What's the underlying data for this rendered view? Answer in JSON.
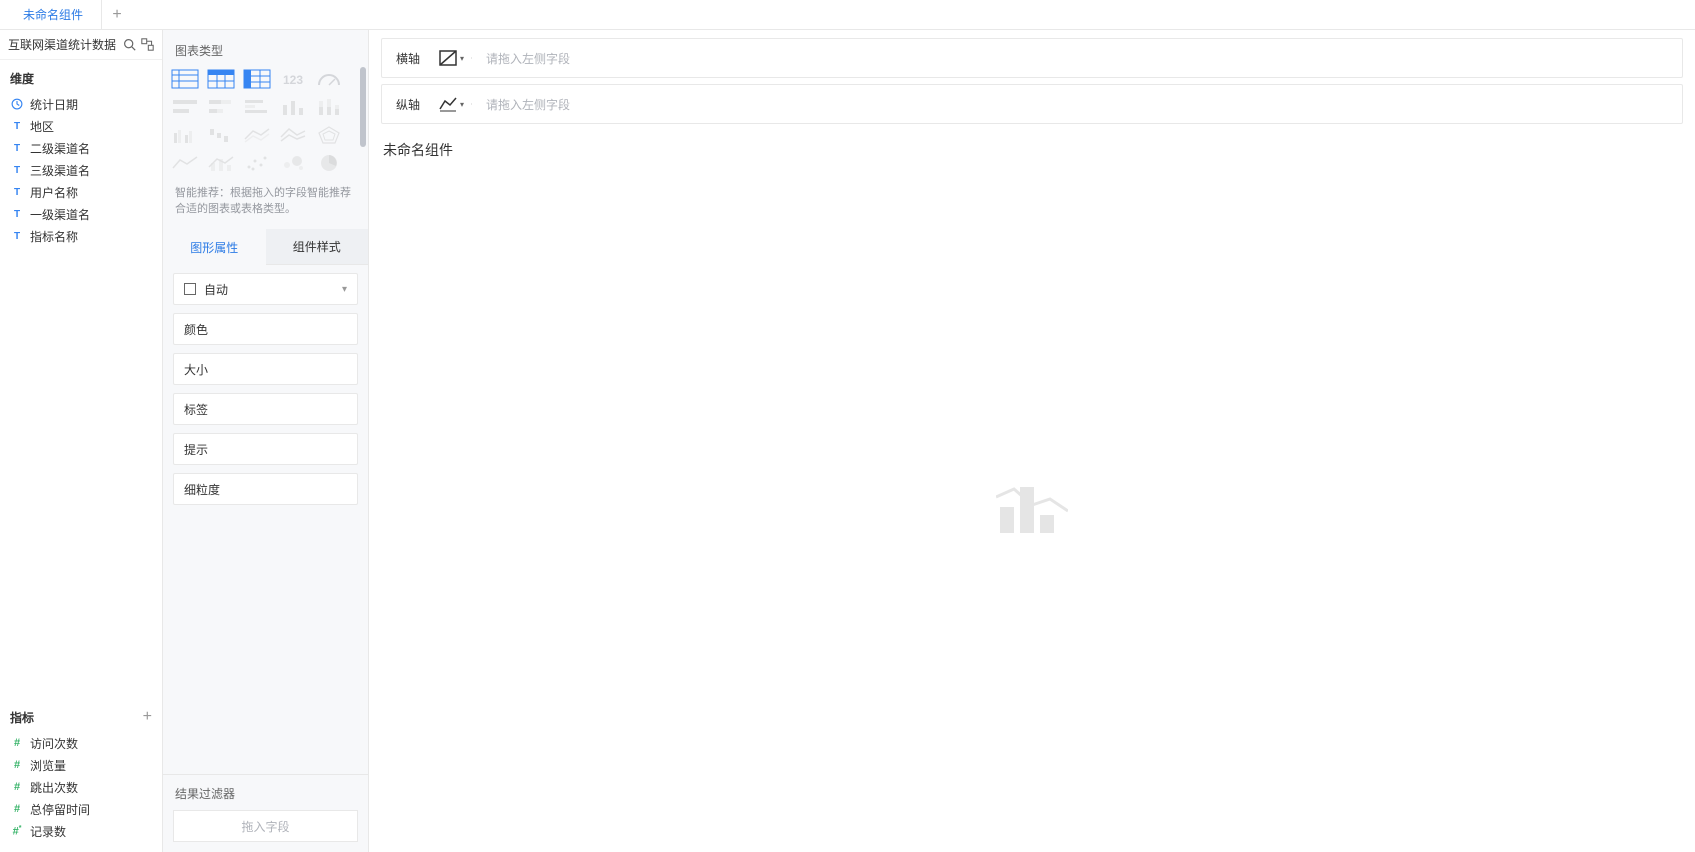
{
  "tabs": {
    "items": [
      "未命名组件"
    ]
  },
  "datasource": {
    "name": "互联网渠道统计数据"
  },
  "dimensions": {
    "title": "维度",
    "items": [
      {
        "type": "clock",
        "label": "统计日期"
      },
      {
        "type": "text",
        "label": "地区"
      },
      {
        "type": "text",
        "label": "二级渠道名"
      },
      {
        "type": "text",
        "label": "三级渠道名"
      },
      {
        "type": "text",
        "label": "用户名称"
      },
      {
        "type": "text",
        "label": "一级渠道名"
      },
      {
        "type": "text",
        "label": "指标名称"
      }
    ]
  },
  "measures": {
    "title": "指标",
    "items": [
      {
        "type": "num",
        "label": "访问次数"
      },
      {
        "type": "num",
        "label": "浏览量"
      },
      {
        "type": "num",
        "label": "跳出次数"
      },
      {
        "type": "num",
        "label": "总停留时间"
      },
      {
        "type": "num-star",
        "label": "记录数"
      }
    ]
  },
  "chartType": {
    "title": "图表类型",
    "hint": "智能推荐：根据拖入的字段智能推荐合适的图表或表格类型。"
  },
  "subtabs": {
    "graphic": "图形属性",
    "style": "组件样式"
  },
  "props": {
    "auto": "自动",
    "color": "颜色",
    "size": "大小",
    "label": "标签",
    "tooltip": "提示",
    "granularity": "细粒度"
  },
  "filter": {
    "title": "结果过滤器",
    "placeholder": "拖入字段"
  },
  "axes": {
    "x": {
      "label": "横轴",
      "placeholder": "请拖入左侧字段"
    },
    "y": {
      "label": "纵轴",
      "placeholder": "请拖入左侧字段"
    }
  },
  "canvas": {
    "title": "未命名组件"
  }
}
